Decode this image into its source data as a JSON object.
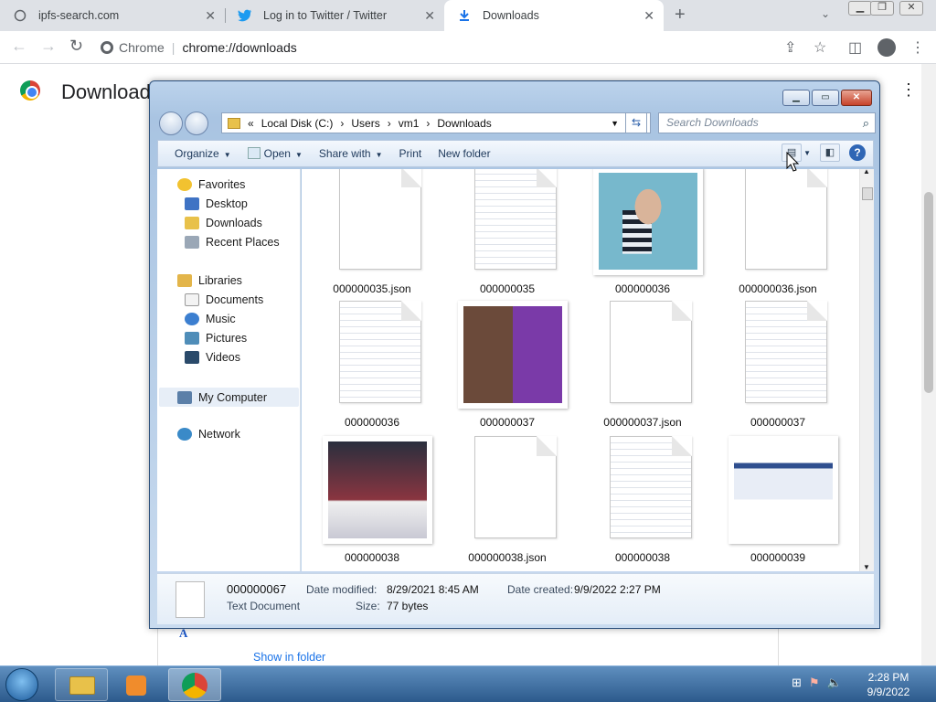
{
  "browser": {
    "tabs": [
      {
        "title": "ipfs-search.com",
        "icon": "globe-icon"
      },
      {
        "title": "Log in to Twitter / Twitter",
        "icon": "twitter-icon"
      },
      {
        "title": "Downloads",
        "icon": "download-icon"
      }
    ],
    "omnibox": {
      "label": "Chrome",
      "url": "chrome://downloads"
    }
  },
  "downloads_page": {
    "title": "Downloads",
    "show_in_folder": "Show in folder"
  },
  "explorer": {
    "address": {
      "prefix": "«",
      "parts": [
        "Local Disk (C:)",
        "Users",
        "vm1",
        "Downloads"
      ]
    },
    "search_placeholder": "Search Downloads",
    "commands": {
      "organize": "Organize",
      "open": "Open",
      "share": "Share with",
      "print": "Print",
      "new_folder": "New folder"
    },
    "nav": {
      "favorites": "Favorites",
      "desktop": "Desktop",
      "downloads": "Downloads",
      "recent": "Recent Places",
      "libraries": "Libraries",
      "documents": "Documents",
      "music": "Music",
      "pictures": "Pictures",
      "videos": "Videos",
      "computer": "My Computer",
      "network": "Network"
    },
    "files": [
      {
        "name": "000000035.json",
        "kind": "blank"
      },
      {
        "name": "000000035",
        "kind": "text"
      },
      {
        "name": "000000036",
        "kind": "photo-child"
      },
      {
        "name": "000000036.json",
        "kind": "blank"
      },
      {
        "name": "000000036",
        "kind": "text"
      },
      {
        "name": "000000037",
        "kind": "photo-people"
      },
      {
        "name": "000000037.json",
        "kind": "blank"
      },
      {
        "name": "000000037",
        "kind": "text"
      },
      {
        "name": "000000038",
        "kind": "photo-football"
      },
      {
        "name": "000000038.json",
        "kind": "blank"
      },
      {
        "name": "000000038",
        "kind": "text"
      },
      {
        "name": "000000039",
        "kind": "photo-table"
      }
    ],
    "details": {
      "name": "000000067",
      "type": "Text Document",
      "modified_label": "Date modified:",
      "modified": "8/29/2021 8:45 AM",
      "size_label": "Size:",
      "size": "77 bytes",
      "created_label": "Date created:",
      "created": "9/9/2022 2:27 PM"
    }
  },
  "taskbar": {
    "time": "2:28 PM",
    "date": "9/9/2022"
  }
}
